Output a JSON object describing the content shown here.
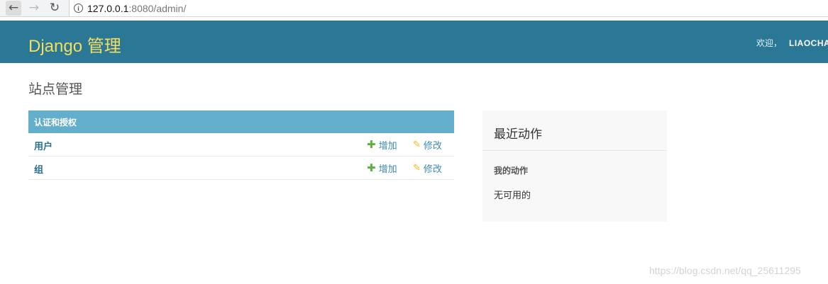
{
  "browser": {
    "url_host": "127.0.0.1",
    "url_rest": ":8080/admin/"
  },
  "header": {
    "site_name": "Django 管理",
    "welcome": "欢迎，",
    "username": "LIAOCHAO"
  },
  "content": {
    "title": "站点管理"
  },
  "app_module": {
    "caption": "认证和授权",
    "models": [
      {
        "name": "用户",
        "add_label": "增加",
        "change_label": "修改"
      },
      {
        "name": "组",
        "add_label": "增加",
        "change_label": "修改"
      }
    ]
  },
  "recent_actions": {
    "title": "最近动作",
    "subtitle": "我的动作",
    "empty_text": "无可用的"
  },
  "watermark": "https://blog.csdn.net/qq_25611295",
  "colors": {
    "header_bg": "#2a7896",
    "branding": "#f5dd5d",
    "caption_bg": "#63aecb",
    "add_icon": "#59b23a",
    "change_icon": "#efb80b"
  },
  "icons": [
    "back-icon",
    "forward-icon",
    "reload-icon",
    "info-icon",
    "plus-icon",
    "pencil-icon"
  ]
}
